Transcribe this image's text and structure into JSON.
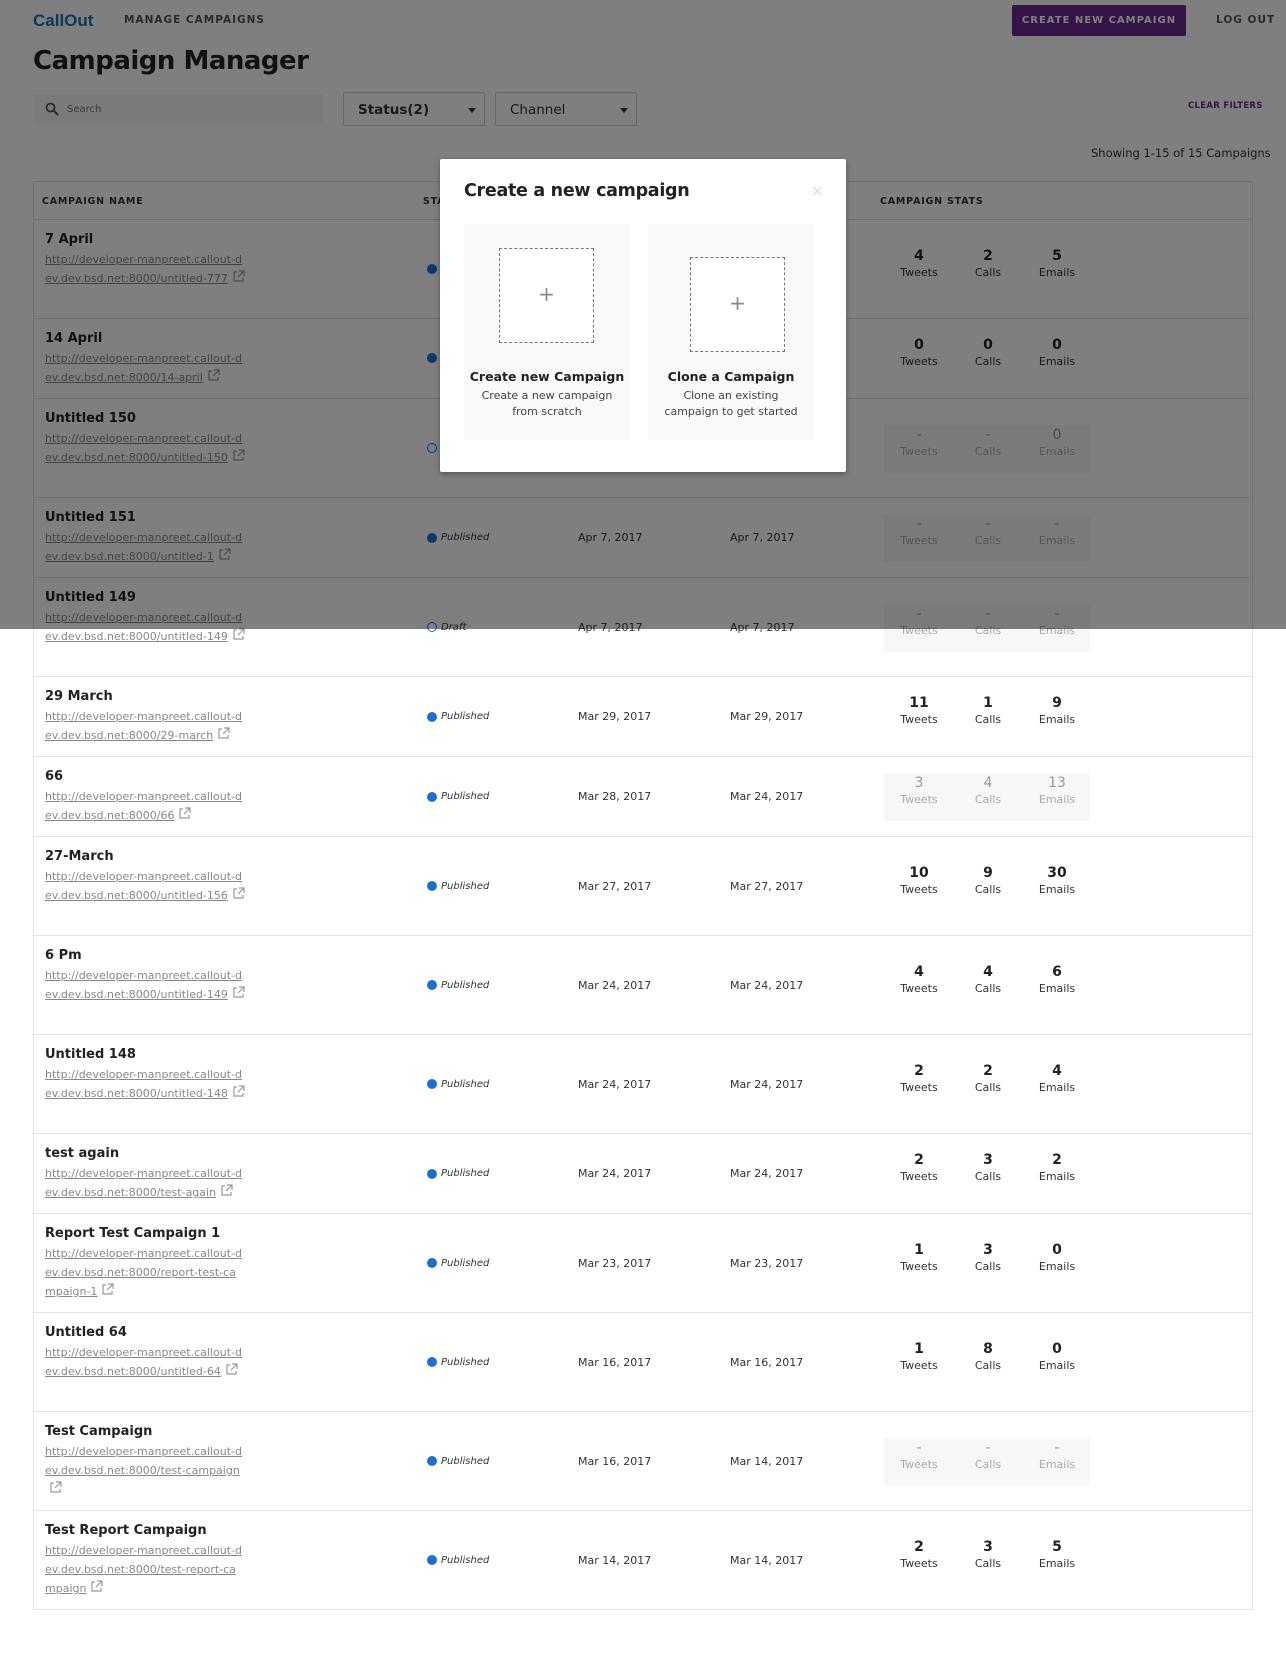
{
  "header": {
    "logo": "CallOut",
    "nav_manage": "MANAGE CAMPAIGNS",
    "create_button": "CREATE NEW CAMPAIGN",
    "logout": "LOG OUT"
  },
  "page_title": "Campaign Manager",
  "filters": {
    "search_placeholder": "Search",
    "status": "Status(2)",
    "channel": "Channel",
    "clear": "CLEAR FILTERS"
  },
  "showing": "Showing 1-15 of 15 Campaigns",
  "table": {
    "headers": {
      "name": "CAMPAIGN NAME",
      "status": "STA",
      "stats": "CAMPAIGN STATS"
    },
    "stat_labels": {
      "tweets": "Tweets",
      "calls": "Calls",
      "emails": "Emails"
    },
    "rows": [
      {
        "name": "7 April",
        "url": "http://developer-manpreet.callout-dev.dev.bsd.net:8000/untitled-777",
        "status": "",
        "status_type": "pub",
        "created": "",
        "modified": "",
        "tweets": "4",
        "calls": "2",
        "emails": "5",
        "dim": false
      },
      {
        "name": "14 April",
        "url": "http://developer-manpreet.callout-dev.dev.bsd.net:8000/14-april",
        "status": "",
        "status_type": "pub",
        "created": "",
        "modified": "",
        "tweets": "0",
        "calls": "0",
        "emails": "0",
        "dim": false
      },
      {
        "name": "Untitled 150",
        "url": "http://developer-manpreet.callout-dev.dev.bsd.net:8000/untitled-150",
        "status": "",
        "status_type": "draft",
        "created": "",
        "modified": "",
        "tweets": "-",
        "calls": "-",
        "emails": "0",
        "dim": true
      },
      {
        "name": "Untitled 151",
        "url": "http://developer-manpreet.callout-dev.dev.bsd.net:8000/untitled-1",
        "status": "Published",
        "status_type": "pub",
        "created": "Apr 7, 2017",
        "modified": "Apr 7, 2017",
        "tweets": "-",
        "calls": "-",
        "emails": "-",
        "dim": true
      },
      {
        "name": "Untitled 149",
        "url": "http://developer-manpreet.callout-dev.dev.bsd.net:8000/untitled-149",
        "status": "Draft",
        "status_type": "draft",
        "created": "Apr 7, 2017",
        "modified": "Apr 7, 2017",
        "tweets": "-",
        "calls": "-",
        "emails": "-",
        "dim": true
      },
      {
        "name": "29 March",
        "url": "http://developer-manpreet.callout-dev.dev.bsd.net:8000/29-march",
        "status": "Published",
        "status_type": "pub",
        "created": "Mar 29, 2017",
        "modified": "Mar 29, 2017",
        "tweets": "11",
        "calls": "1",
        "emails": "9",
        "dim": false
      },
      {
        "name": "66",
        "url": "http://developer-manpreet.callout-dev.dev.bsd.net:8000/66",
        "status": "Published",
        "status_type": "pub",
        "created": "Mar 28, 2017",
        "modified": "Mar 24, 2017",
        "tweets": "3",
        "calls": "4",
        "emails": "13",
        "dim": true
      },
      {
        "name": "27-March",
        "url": "http://developer-manpreet.callout-dev.dev.bsd.net:8000/untitled-156",
        "status": "Published",
        "status_type": "pub",
        "created": "Mar 27, 2017",
        "modified": "Mar 27, 2017",
        "tweets": "10",
        "calls": "9",
        "emails": "30",
        "dim": false
      },
      {
        "name": "6 Pm",
        "url": "http://developer-manpreet.callout-dev.dev.bsd.net:8000/untitled-149",
        "status": "Published",
        "status_type": "pub",
        "created": "Mar 24, 2017",
        "modified": "Mar 24, 2017",
        "tweets": "4",
        "calls": "4",
        "emails": "6",
        "dim": false
      },
      {
        "name": "Untitled 148",
        "url": "http://developer-manpreet.callout-dev.dev.bsd.net:8000/untitled-148",
        "status": "Published",
        "status_type": "pub",
        "created": "Mar 24, 2017",
        "modified": "Mar 24, 2017",
        "tweets": "2",
        "calls": "2",
        "emails": "4",
        "dim": false
      },
      {
        "name": "test again",
        "url": "http://developer-manpreet.callout-dev.dev.bsd.net:8000/test-again",
        "status": "Published",
        "status_type": "pub",
        "created": "Mar 24, 2017",
        "modified": "Mar 24, 2017",
        "tweets": "2",
        "calls": "3",
        "emails": "2",
        "dim": false
      },
      {
        "name": "Report Test Campaign 1",
        "url": "http://developer-manpreet.callout-dev.dev.bsd.net:8000/report-test-campaign-1",
        "status": "Published",
        "status_type": "pub",
        "created": "Mar 23, 2017",
        "modified": "Mar 23, 2017",
        "tweets": "1",
        "calls": "3",
        "emails": "0",
        "dim": false
      },
      {
        "name": "Untitled 64",
        "url": "http://developer-manpreet.callout-dev.dev.bsd.net:8000/untitled-64",
        "status": "Published",
        "status_type": "pub",
        "created": "Mar 16, 2017",
        "modified": "Mar 16, 2017",
        "tweets": "1",
        "calls": "8",
        "emails": "0",
        "dim": false
      },
      {
        "name": "Test Campaign",
        "url": "http://developer-manpreet.callout-dev.dev.bsd.net:8000/test-campaign",
        "status": "Published",
        "status_type": "pub",
        "created": "Mar 16, 2017",
        "modified": "Mar 14, 2017",
        "tweets": "-",
        "calls": "-",
        "emails": "-",
        "dim": true
      },
      {
        "name": "Test Report Campaign",
        "url": "http://developer-manpreet.callout-dev.dev.bsd.net:8000/test-report-campaign",
        "status": "Published",
        "status_type": "pub",
        "created": "Mar 14, 2017",
        "modified": "Mar 14, 2017",
        "tweets": "2",
        "calls": "3",
        "emails": "5",
        "dim": false
      }
    ]
  },
  "modal": {
    "title": "Create a new campaign",
    "close": "×",
    "options": [
      {
        "plus": "+",
        "title": "Create new Campaign",
        "desc": "Create a new campaign from scratch"
      },
      {
        "plus": "+",
        "title": "Clone a Campaign",
        "desc": "Clone an existing campaign to get started"
      }
    ]
  },
  "colors": {
    "brand": "#1f6fb5",
    "accent": "#6b2a8f",
    "status_dot": "#1f6fd0"
  },
  "icons": {
    "search": "search-icon",
    "external_link": "external-link-icon",
    "caret": "caret-down-icon",
    "close": "close-icon",
    "plus": "plus-icon"
  }
}
